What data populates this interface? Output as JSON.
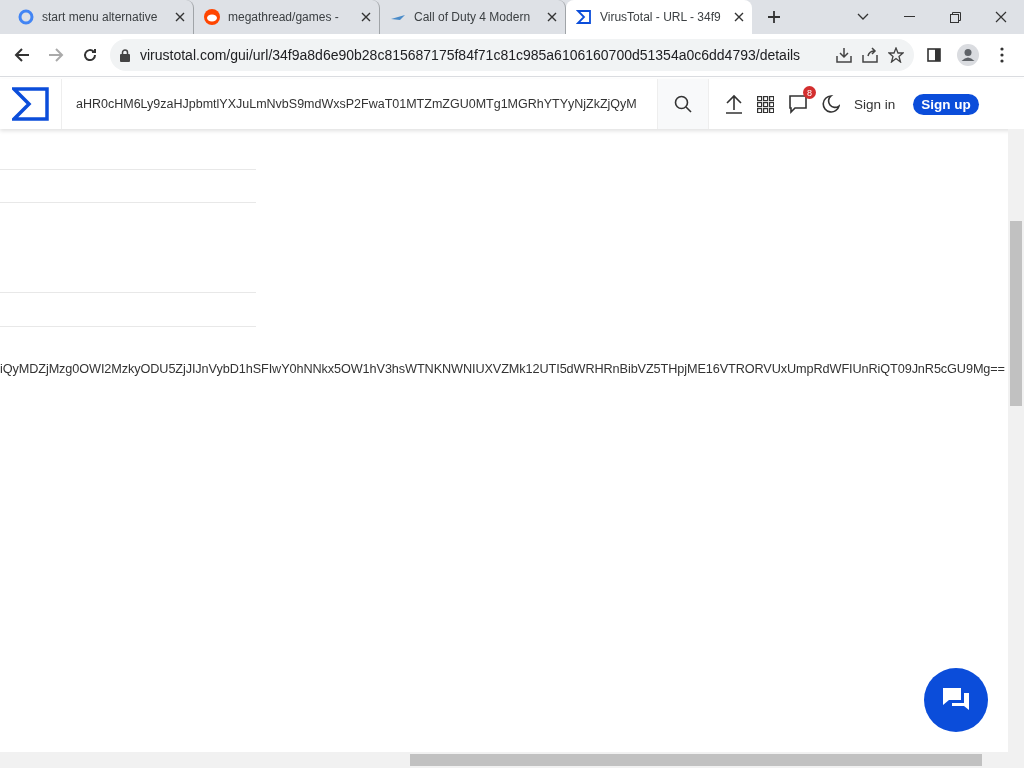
{
  "browser": {
    "tabs": [
      {
        "title": "start menu alternative",
        "kind": "google",
        "selected": false
      },
      {
        "title": "megathread/games - ",
        "kind": "reddit",
        "selected": false
      },
      {
        "title": "Call of Duty 4 Modern",
        "kind": "plane",
        "selected": false
      },
      {
        "title": "VirusTotal - URL - 34f9",
        "kind": "sigma",
        "selected": true
      }
    ],
    "address": "virustotal.com/gui/url/34f9a8d6e90b28c815687175f84f71c81c985a6106160700d51354a0c6dd4793/details"
  },
  "header": {
    "search_value": "aHR0cHM6Ly9zaHJpbmtlYXJuLmNvbS9mdWxsP2FwaT01MTZmZGU0MTg1MGRhYTYyNjZkZjQyM",
    "notifications": "8",
    "sign_in": "Sign in",
    "sign_up": "Sign up"
  },
  "content": {
    "encoded_text": "iQyMDZjMzg0OWI2MzkyODU5ZjJIJnVybD1hSFIwY0hNNkx5OW1hV3hsWTNKNWNIUXVZMk12UTI5dWRHRnBibVZ5THpjME16VTRORVUxUmpRdWFIUnRiQT09JnR5cGU9Mg=="
  }
}
